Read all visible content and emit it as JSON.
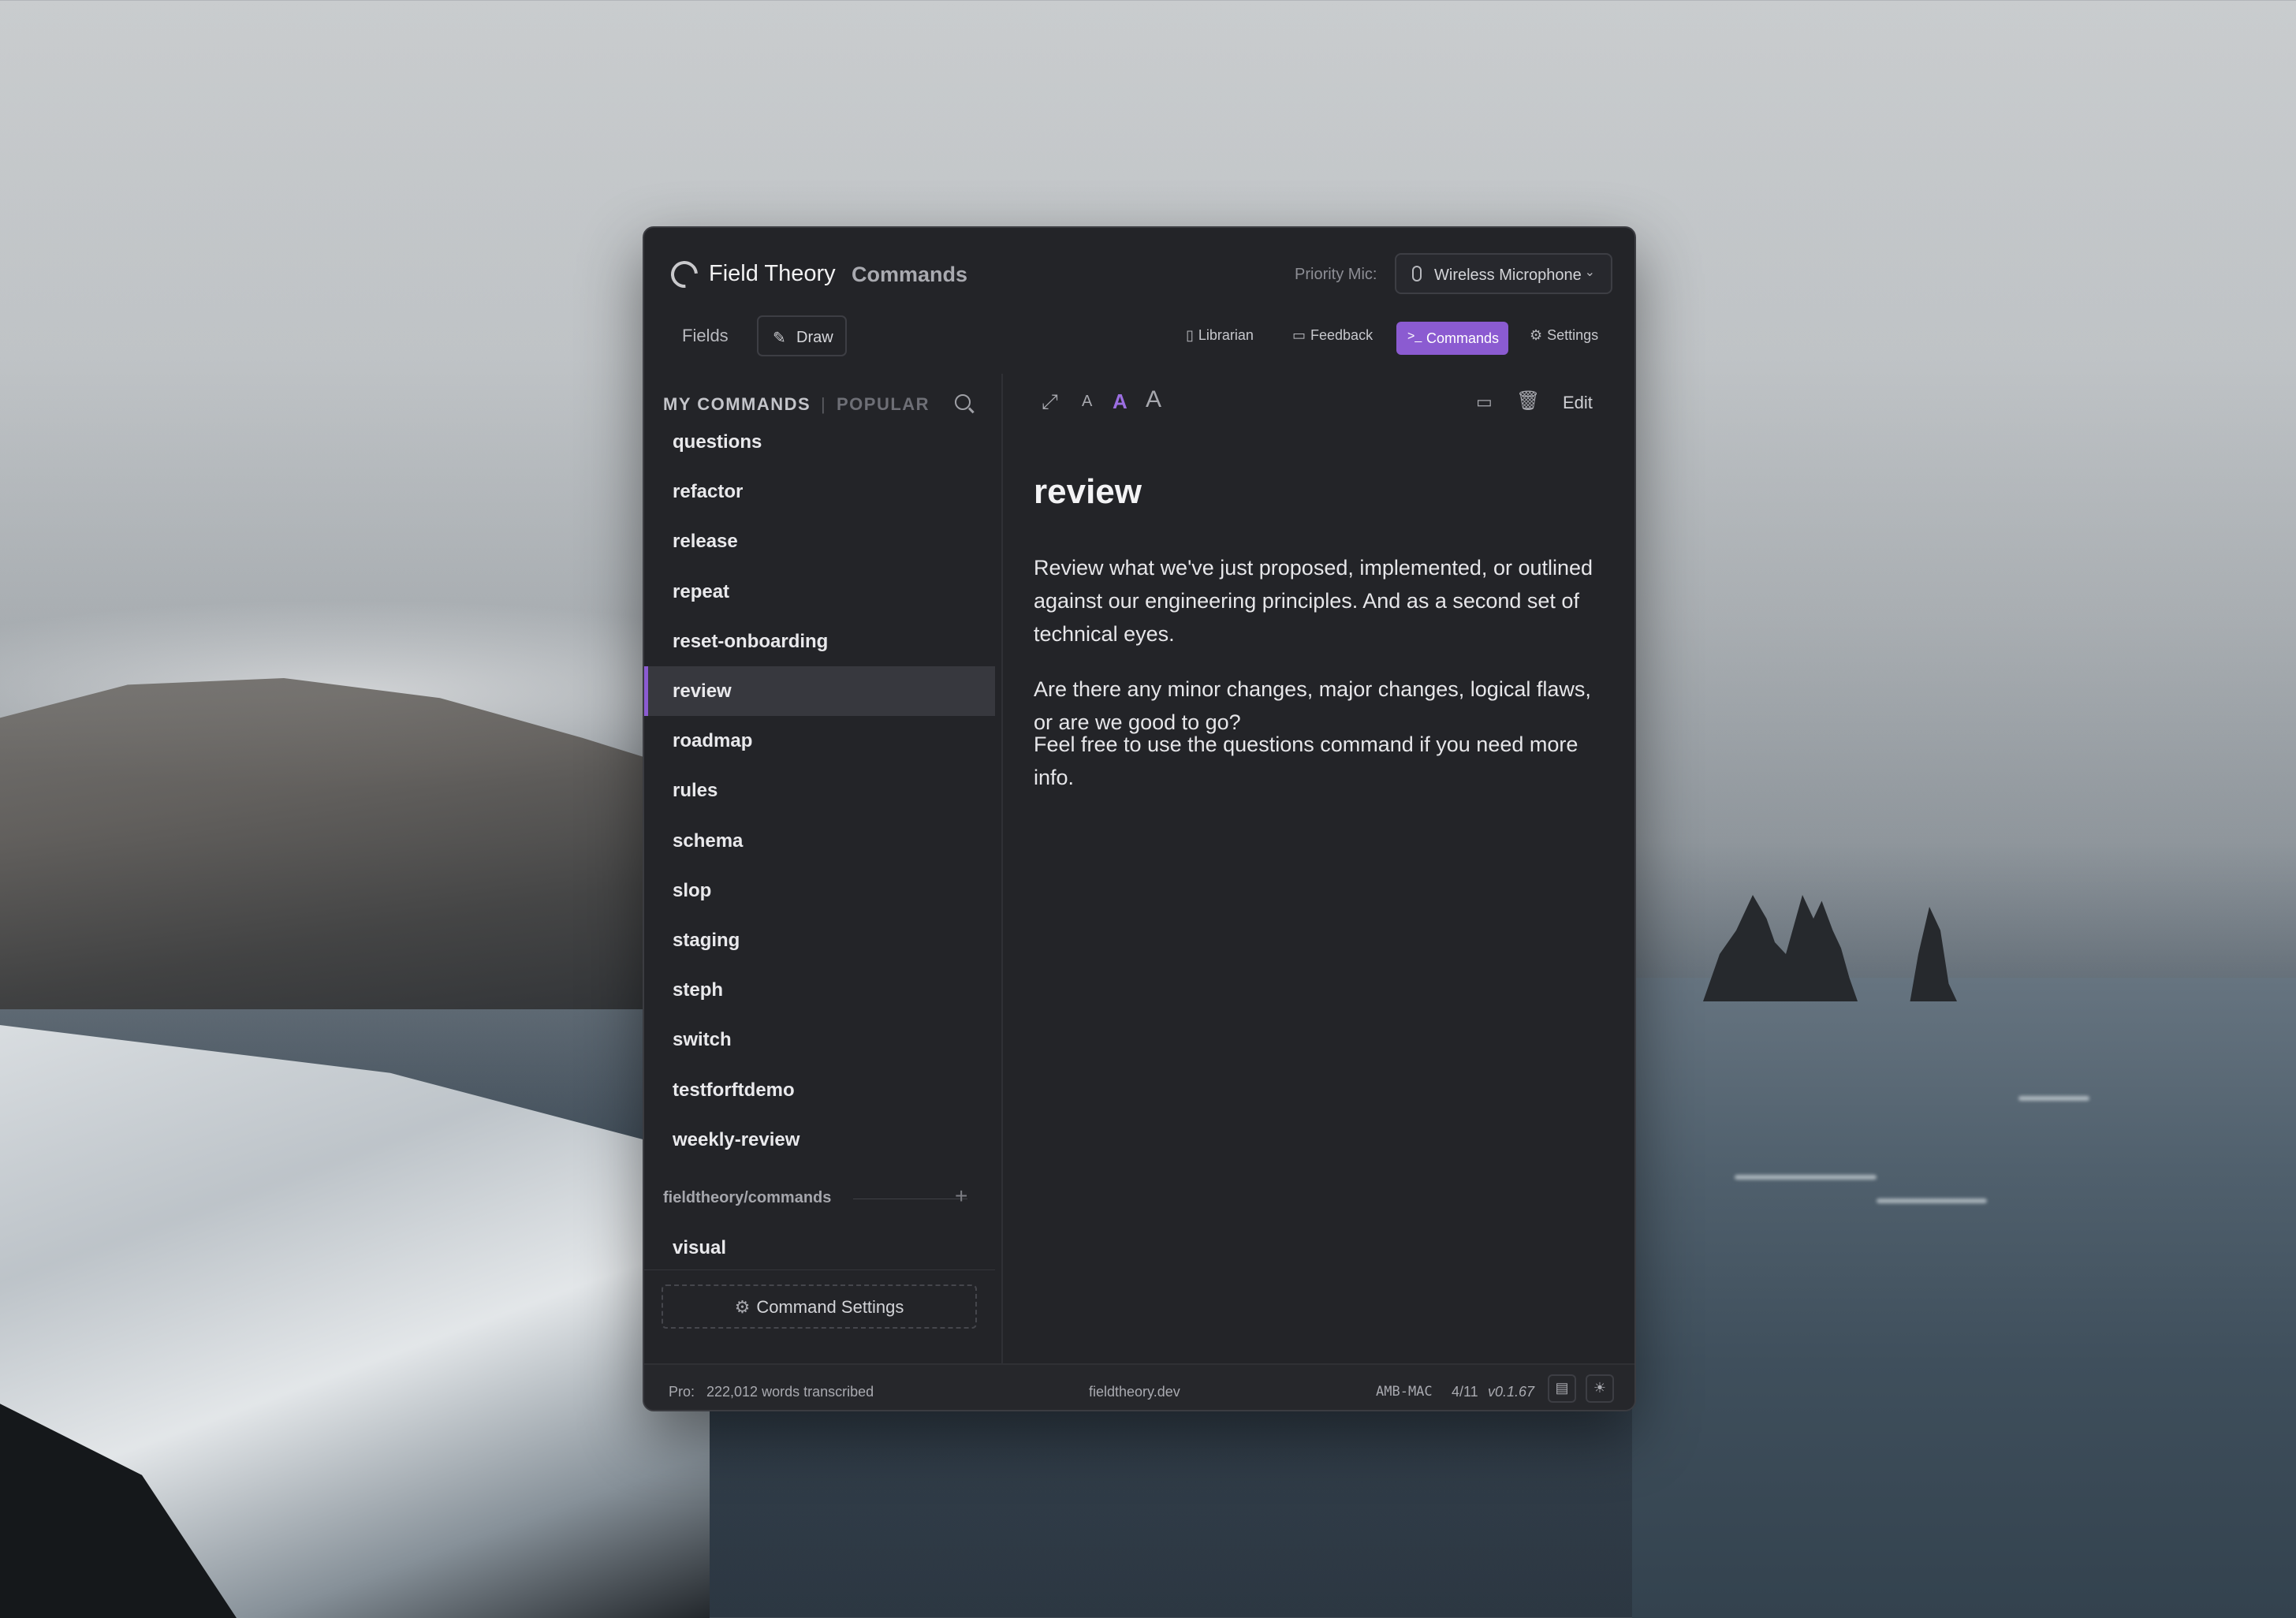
{
  "app": {
    "name": "Field Theory",
    "section": "Commands"
  },
  "mic": {
    "label": "Priority Mic:",
    "value": "Wireless Microphone"
  },
  "nav": {
    "fields": "Fields",
    "draw": "Draw",
    "librarian": "Librarian",
    "feedback": "Feedback",
    "commands": "Commands",
    "settings": "Settings"
  },
  "sidebar": {
    "tabs": {
      "my": "MY COMMANDS",
      "sep": "|",
      "popular": "POPULAR"
    },
    "items": [
      {
        "label": "questions",
        "active": false
      },
      {
        "label": "refactor",
        "active": false
      },
      {
        "label": "release",
        "active": false
      },
      {
        "label": "repeat",
        "active": false
      },
      {
        "label": "reset-onboarding",
        "active": false
      },
      {
        "label": "review",
        "active": true
      },
      {
        "label": "roadmap",
        "active": false
      },
      {
        "label": "rules",
        "active": false
      },
      {
        "label": "schema",
        "active": false
      },
      {
        "label": "slop",
        "active": false
      },
      {
        "label": "staging",
        "active": false
      },
      {
        "label": "steph",
        "active": false
      },
      {
        "label": "switch",
        "active": false
      },
      {
        "label": "testforftdemo",
        "active": false
      },
      {
        "label": "weekly-review",
        "active": false
      }
    ],
    "repo": {
      "label": "fieldtheory/commands",
      "items": [
        {
          "label": "visual"
        }
      ]
    },
    "settings_button": "Command Settings"
  },
  "toolbar": {
    "font_small": "A",
    "font_medium": "A",
    "font_large": "A",
    "edit": "Edit",
    "icons": [
      "expand-icon",
      "folder-icon",
      "trash-icon"
    ]
  },
  "content": {
    "title": "review",
    "paragraphs": [
      "Review what we've just proposed, implemented, or outlined against our engineering principles. And as a second set of technical eyes.",
      "Are there any minor changes, major changes, logical flaws, or are we good to go?",
      "Feel free to use the questions command if you need more info."
    ]
  },
  "footer": {
    "plan": "Pro:",
    "words": "222,012 words transcribed",
    "site": "fieldtheory.dev",
    "machine": "AMB-MAC",
    "date": "4/11",
    "version": "v0.1.67"
  },
  "colors": {
    "accent": "#8b5bd1",
    "window_bg": "#232428",
    "active_row": "#37383e"
  }
}
